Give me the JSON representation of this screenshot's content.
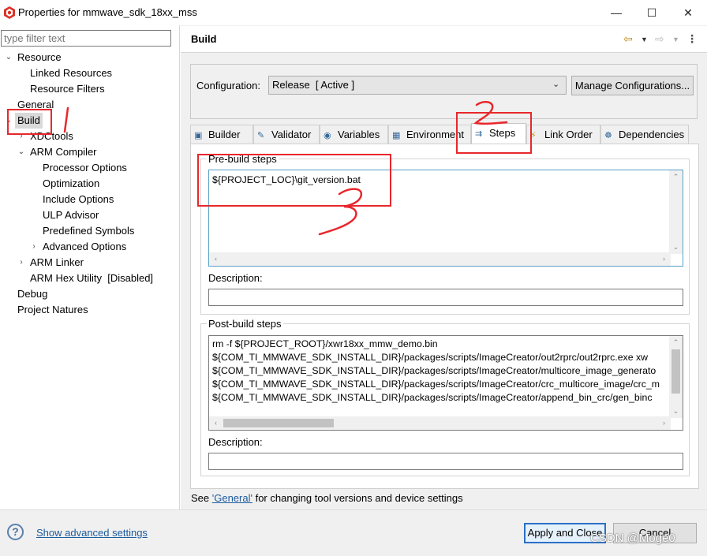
{
  "window": {
    "title": "Properties for mmwave_sdk_18xx_mss",
    "controls": {
      "minimize": "—",
      "maximize": "☐",
      "close": "✕"
    }
  },
  "sidebar": {
    "filter_placeholder": "type filter text",
    "items": [
      {
        "label": "Resource",
        "expanded": true
      },
      {
        "label": "Linked Resources"
      },
      {
        "label": "Resource Filters"
      },
      {
        "label": "General"
      },
      {
        "label": "Build",
        "expanded": true,
        "selected": true
      },
      {
        "label": "XDCtools",
        "collapsed": true
      },
      {
        "label": "ARM Compiler",
        "expanded": true
      },
      {
        "label": "Processor Options"
      },
      {
        "label": "Optimization"
      },
      {
        "label": "Include Options"
      },
      {
        "label": "ULP Advisor"
      },
      {
        "label": "Predefined Symbols"
      },
      {
        "label": "Advanced Options",
        "collapsed": true
      },
      {
        "label": "ARM Linker",
        "collapsed": true
      },
      {
        "label": "ARM Hex Utility  [Disabled]"
      },
      {
        "label": "Debug"
      },
      {
        "label": "Project Natures"
      }
    ]
  },
  "main": {
    "title": "Build",
    "configuration_label": "Configuration:",
    "configuration_value": "Release  [ Active ]",
    "manage_button": "Manage Configurations...",
    "tabs": [
      {
        "label": "Builder",
        "icon": "builder-icon"
      },
      {
        "label": "Validator",
        "icon": "validator-icon"
      },
      {
        "label": "Variables",
        "icon": "variables-icon"
      },
      {
        "label": "Environment",
        "icon": "environment-icon"
      },
      {
        "label": "Steps",
        "icon": "steps-icon",
        "active": true
      },
      {
        "label": "Link Order",
        "icon": "link-order-icon"
      },
      {
        "label": "Dependencies",
        "icon": "dependencies-icon"
      }
    ],
    "pre_build": {
      "title": "Pre-build steps",
      "lines": [
        "${PROJECT_LOC}\\git_version.bat"
      ],
      "description_label": "Description:",
      "description_value": ""
    },
    "post_build": {
      "title": "Post-build steps",
      "lines": [
        "rm -f ${PROJECT_ROOT}/xwr18xx_mmw_demo.bin",
        "${COM_TI_MMWAVE_SDK_INSTALL_DIR}/packages/scripts/ImageCreator/out2rprc/out2rprc.exe xw",
        "${COM_TI_MMWAVE_SDK_INSTALL_DIR}/packages/scripts/ImageCreator/multicore_image_generato",
        "${COM_TI_MMWAVE_SDK_INSTALL_DIR}/packages/scripts/ImageCreator/crc_multicore_image/crc_m",
        "${COM_TI_MMWAVE_SDK_INSTALL_DIR}/packages/scripts/ImageCreator/append_bin_crc/gen_binc"
      ],
      "description_label": "Description:",
      "description_value": ""
    },
    "see_general": {
      "prefix": "See ",
      "link": "'General'",
      "suffix": " for changing tool versions and device settings"
    }
  },
  "footer": {
    "advanced_link": "Show advanced settings",
    "apply_button": "Apply and Close",
    "cancel_button": "Cancel"
  },
  "watermark": "CSDN @Moge0",
  "annotations": {
    "color": "#e8272c",
    "marks": [
      "1",
      "2",
      "3"
    ]
  }
}
